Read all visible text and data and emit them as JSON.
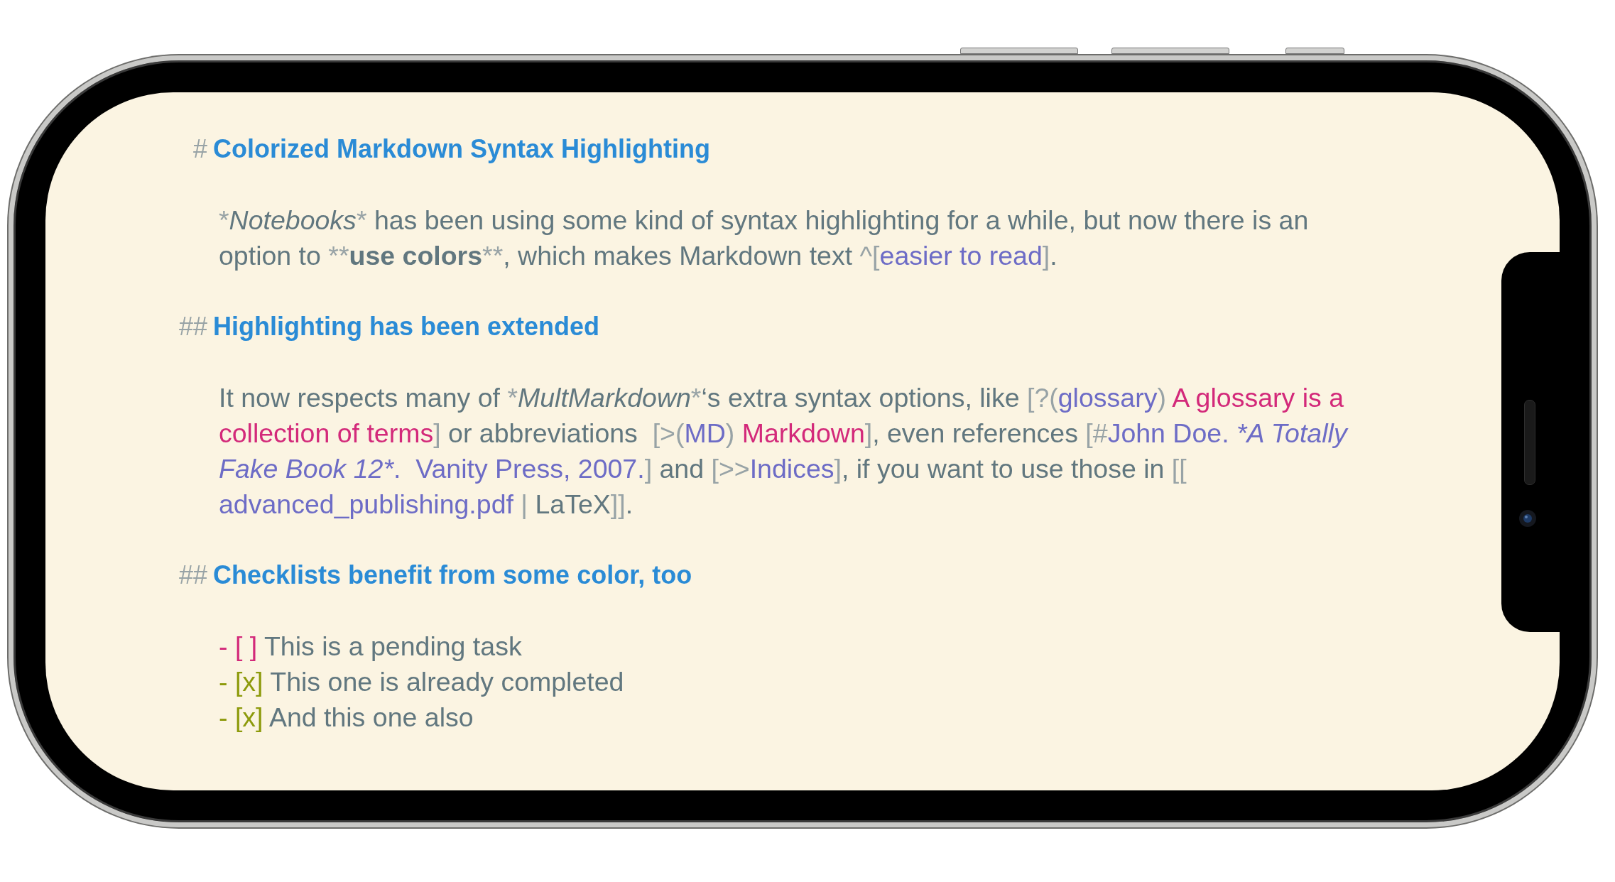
{
  "blocks": [
    {
      "kind": "heading",
      "marker": "#",
      "text": "Colorized Markdown Syntax Highlighting"
    },
    {
      "kind": "paragraph",
      "segments": [
        {
          "kind": "mark",
          "text": "*"
        },
        {
          "kind": "emph",
          "text": "Notebooks"
        },
        {
          "kind": "mark",
          "text": "*"
        },
        {
          "kind": "text",
          "text": " has been using some kind of syntax highlighting for a while, but now there is an option to "
        },
        {
          "kind": "mark",
          "text": "**"
        },
        {
          "kind": "strong",
          "text": "use colors"
        },
        {
          "kind": "mark",
          "text": "**"
        },
        {
          "kind": "text",
          "text": ", which makes Markdown text "
        },
        {
          "kind": "mark",
          "text": "^["
        },
        {
          "kind": "link",
          "text": "easier to read"
        },
        {
          "kind": "mark",
          "text": "]"
        },
        {
          "kind": "text",
          "text": "."
        }
      ]
    },
    {
      "kind": "heading",
      "marker": "##",
      "text": "Highlighting has been extended"
    },
    {
      "kind": "paragraph",
      "segments": [
        {
          "kind": "text",
          "text": "It now respects many of "
        },
        {
          "kind": "mark",
          "text": "*"
        },
        {
          "kind": "emph",
          "text": "MultMarkdown"
        },
        {
          "kind": "mark",
          "text": "*"
        },
        {
          "kind": "text",
          "text": "‘s extra syntax options, like "
        },
        {
          "kind": "mark",
          "text": "[?("
        },
        {
          "kind": "link",
          "text": "glossary"
        },
        {
          "kind": "mark",
          "text": ")"
        },
        {
          "kind": "accent",
          "text": " A glossary is a collection of terms"
        },
        {
          "kind": "mark",
          "text": "]"
        },
        {
          "kind": "text",
          "text": " or abbreviations  "
        },
        {
          "kind": "mark",
          "text": "[>("
        },
        {
          "kind": "link",
          "text": "MD"
        },
        {
          "kind": "mark",
          "text": ")"
        },
        {
          "kind": "accent",
          "text": " Markdown"
        },
        {
          "kind": "mark",
          "text": "]"
        },
        {
          "kind": "text",
          "text": ", even references "
        },
        {
          "kind": "mark",
          "text": "[#"
        },
        {
          "kind": "link",
          "text": "John Doe. "
        },
        {
          "kind": "link-emph",
          "text": "*A Totally Fake Book 12*"
        },
        {
          "kind": "link",
          "text": ".  Vanity Press, 2007."
        },
        {
          "kind": "mark",
          "text": "]"
        },
        {
          "kind": "text",
          "text": " and "
        },
        {
          "kind": "mark",
          "text": "[>>"
        },
        {
          "kind": "link",
          "text": "Indices"
        },
        {
          "kind": "mark",
          "text": "]"
        },
        {
          "kind": "text",
          "text": ", if you want to use those in "
        },
        {
          "kind": "mark",
          "text": "[["
        },
        {
          "kind": "link",
          "text": " advanced_publishing.pdf "
        },
        {
          "kind": "mark",
          "text": "|"
        },
        {
          "kind": "text",
          "text": " LaTeX"
        },
        {
          "kind": "mark",
          "text": "]]"
        },
        {
          "kind": "text",
          "text": "."
        }
      ]
    },
    {
      "kind": "heading",
      "marker": "##",
      "text": "Checklists benefit from some color, too"
    },
    {
      "kind": "checklist",
      "items": [
        {
          "bullet": "-",
          "box": "[ ]",
          "label": "This is a pending task",
          "checked": false
        },
        {
          "bullet": "-",
          "box": "[x]",
          "label": "This one is already completed",
          "checked": true
        },
        {
          "bullet": "-",
          "box": "[x]",
          "label": "And this one also",
          "checked": true
        }
      ]
    }
  ]
}
